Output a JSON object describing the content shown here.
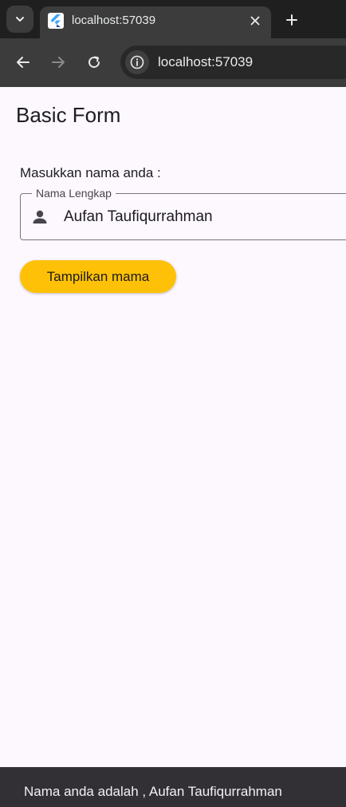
{
  "browser": {
    "tab": {
      "title": "localhost:57039"
    },
    "address_bar": {
      "url": "localhost:57039"
    },
    "icons": [
      "tab-search-icon",
      "flutter-favicon-icon",
      "close-icon",
      "plus-icon",
      "back-icon",
      "forward-icon",
      "reload-icon",
      "site-info-icon"
    ],
    "colors": {
      "tabstrip": "#1f1f1f",
      "toolbar": "#3c3c3c",
      "omnibox": "#282828"
    }
  },
  "app": {
    "title": "Basic Form",
    "form": {
      "caption": "Masukkan nama anda :",
      "name_field": {
        "label": "Nama Lengkap",
        "value": "Aufan Taufiqurrahman",
        "icon": "person-icon"
      },
      "submit_label": "Tampilkan mama"
    },
    "snackbar": {
      "message": "Nama anda adalah , Aufan Taufiqurrahman"
    },
    "colors": {
      "background": "#fdf7fe",
      "button": "#ffc107",
      "snackbar": "#322f35"
    }
  }
}
